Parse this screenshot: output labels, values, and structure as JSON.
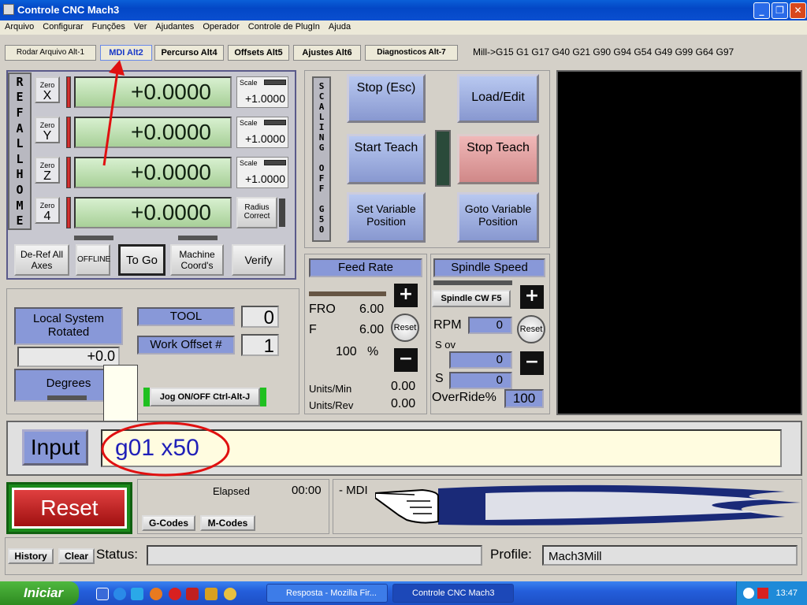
{
  "window": {
    "title": "Controle CNC Mach3"
  },
  "menu": [
    "Arquivo",
    "Configurar",
    "Funções",
    "Ver",
    "Ajudantes",
    "Operador",
    "Controle de PlugIn",
    "Ajuda"
  ],
  "tabs": [
    "Rodar Arquivo Alt-1",
    "MDI Alt2",
    "Percurso Alt4",
    "Offsets Alt5",
    "Ajustes Alt6",
    "Diagnosticos Alt-7"
  ],
  "active_tab": "MDI Alt2",
  "modal_gcodes": "Mill->G15  G1 G17 G40 G21 G90 G94 G54 G49 G99 G64 G97",
  "ref_all_home": [
    "R",
    "E",
    "F",
    "",
    "A",
    "L",
    "L",
    "",
    "H",
    "O",
    "M",
    "E"
  ],
  "axes": [
    {
      "zero_label": "Zero",
      "axis": "X",
      "dro": "+0.0000",
      "scale_label": "Scale",
      "scale": "+1.0000"
    },
    {
      "zero_label": "Zero",
      "axis": "Y",
      "dro": "+0.0000",
      "scale_label": "Scale",
      "scale": "+1.0000"
    },
    {
      "zero_label": "Zero",
      "axis": "Z",
      "dro": "+0.0000",
      "scale_label": "Scale",
      "scale": "+1.0000"
    },
    {
      "zero_label": "Zero",
      "axis": "4",
      "dro": "+0.0000",
      "radius_label": "Radius Correct"
    }
  ],
  "dro_buttons": {
    "deref": "De-Ref All Axes",
    "offline": "OFFLINE",
    "togo": "To Go",
    "machine": "Machine Coord's",
    "verify": "Verify"
  },
  "scaling": [
    "S",
    "C",
    "A",
    "L",
    "I",
    "N",
    "G",
    "",
    "O",
    "F",
    "F",
    "",
    "G",
    "5",
    "0"
  ],
  "teach": {
    "stop": "Stop (Esc)",
    "load": "Load/Edit",
    "start_teach": "Start Teach",
    "stop_teach": "Stop Teach",
    "set_var": "Set Variable Position",
    "goto_var": "Goto Variable Position"
  },
  "local": {
    "title": "Local System Rotated",
    "value": "+0.0",
    "degrees": "Degrees"
  },
  "tool": {
    "label": "TOOL",
    "value": "0",
    "work_offset_label": "Work Offset #",
    "work_offset": "1",
    "jog": "Jog ON/OFF Ctrl-Alt-J"
  },
  "feed": {
    "title": "Feed Rate",
    "fro_label": "FRO",
    "fro": "6.00",
    "f_label": "F",
    "f": "6.00",
    "pct": "100",
    "pct_sign": "%",
    "reset": "Reset",
    "units_min_label": "Units/Min",
    "units_min": "0.00",
    "units_rev_label": "Units/Rev",
    "units_rev": "0.00"
  },
  "spindle": {
    "title": "Spindle Speed",
    "cw": "Spindle CW F5",
    "rpm_label": "RPM",
    "rpm": "0",
    "reset": "Reset",
    "sov_label": "S ov",
    "sov": "0",
    "s_label": "S",
    "s": "0",
    "override_label": "OverRide%",
    "override": "100"
  },
  "input": {
    "label": "Input",
    "value": "g01 x50"
  },
  "bottom": {
    "reset": "Reset",
    "elapsed_label": "Elapsed",
    "elapsed": "00:00",
    "gcodes": "G-Codes",
    "mcodes": "M-Codes",
    "mode": "- MDI"
  },
  "status": {
    "history": "History",
    "clear": "Clear",
    "label": "Status:",
    "value": "",
    "profile_label": "Profile:",
    "profile": "Mach3Mill"
  },
  "taskbar": {
    "start": "Iniciar",
    "items": [
      "Resposta - Mozilla Fir...",
      "Controle CNC Mach3"
    ],
    "clock": "13:47"
  },
  "colors": {
    "annotation": "#e01010",
    "input_text": "#2020b8",
    "title_blue": "#0347c6"
  }
}
